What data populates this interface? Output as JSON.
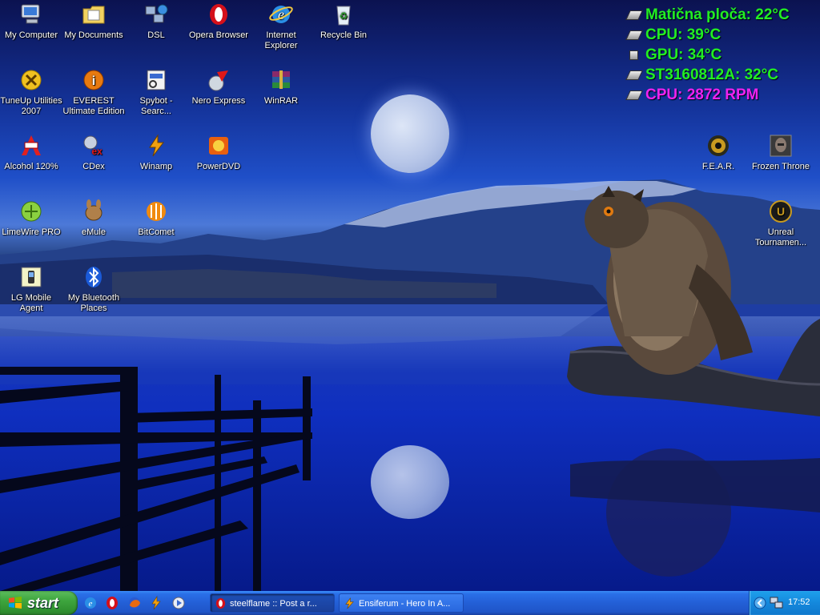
{
  "desktop": {
    "icons": [
      {
        "label": "My Computer",
        "icon": "computer-icon"
      },
      {
        "label": "My Documents",
        "icon": "folder-documents-icon"
      },
      {
        "label": "DSL",
        "icon": "network-connection-icon"
      },
      {
        "label": "Opera Browser",
        "icon": "opera-icon"
      },
      {
        "label": "Internet Explorer",
        "icon": "internet-explorer-icon"
      },
      {
        "label": "Recycle Bin",
        "icon": "recycle-bin-icon"
      },
      {
        "label": "TuneUp Utilities 2007",
        "icon": "tuneup-icon"
      },
      {
        "label": "EVEREST Ultimate Edition",
        "icon": "everest-icon"
      },
      {
        "label": "Spybot - Searc...",
        "icon": "spybot-icon"
      },
      {
        "label": "Nero Express",
        "icon": "nero-icon"
      },
      {
        "label": "WinRAR",
        "icon": "winrar-icon"
      },
      {
        "label": "Alcohol 120%",
        "icon": "alcohol-icon"
      },
      {
        "label": "CDex",
        "icon": "cdex-icon"
      },
      {
        "label": "Winamp",
        "icon": "winamp-icon"
      },
      {
        "label": "PowerDVD",
        "icon": "powerdvd-icon"
      },
      {
        "label": "LimeWire PRO",
        "icon": "limewire-icon"
      },
      {
        "label": "eMule",
        "icon": "emule-icon"
      },
      {
        "label": "BitComet",
        "icon": "bitcomet-icon"
      },
      {
        "label": "LG Mobile Agent",
        "icon": "lg-mobile-icon"
      },
      {
        "label": "My Bluetooth Places",
        "icon": "bluetooth-icon"
      },
      {
        "label": "F.E.A.R.",
        "icon": "fear-game-icon"
      },
      {
        "label": "Frozen Throne",
        "icon": "frozen-throne-icon"
      },
      {
        "label": "Unreal Tournamen...",
        "icon": "unreal-tournament-icon"
      }
    ],
    "sensors": [
      {
        "text": "Matična ploča: 22°C",
        "color": "#22ee22"
      },
      {
        "text": "CPU: 39°C",
        "color": "#22ee22"
      },
      {
        "text": "GPU: 34°C",
        "color": "#22ee22"
      },
      {
        "text": "ST3160812A: 32°C",
        "color": "#22ee22"
      },
      {
        "text": "CPU: 2872 RPM",
        "color": "#ee22ee"
      }
    ]
  },
  "taskbar": {
    "start_label": "start",
    "quick_launch": [
      "internet-explorer-icon",
      "opera-icon",
      "firefox-icon",
      "winamp-icon",
      "media-player-icon"
    ],
    "windows": [
      {
        "title": "steelflame :: Post a r...",
        "icon": "opera-icon",
        "active": true
      },
      {
        "title": "Ensiferum - Hero In A...",
        "icon": "winamp-icon",
        "active": false
      }
    ],
    "tray": {
      "icons": [
        "show-hidden-icon",
        "network-icon"
      ],
      "clock": "17:52"
    }
  },
  "colors": {
    "taskbar_blue": "#235fd6",
    "start_green": "#3ea53e",
    "tray_blue": "#1488dc",
    "sensor_green": "#22ee22",
    "sensor_magenta": "#ee22ee"
  }
}
